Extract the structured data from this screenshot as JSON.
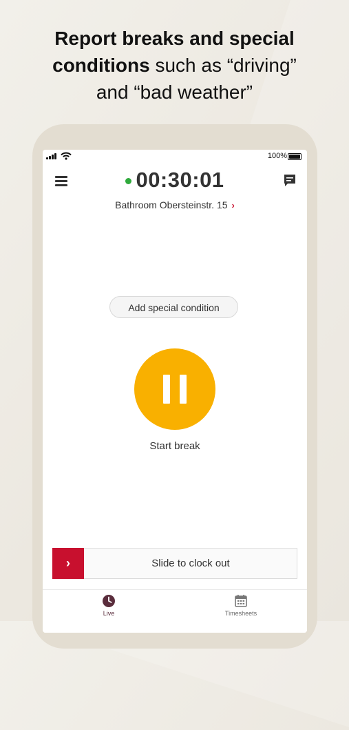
{
  "headline": {
    "line1_bold": "Report breaks and special",
    "line2_bold": "conditions",
    "line2_rest": " such as “driving”",
    "line3": "and “bad weather”"
  },
  "status_bar": {
    "battery": "100%"
  },
  "timer": {
    "value": "00:30:01",
    "status_color": "#2faa3c"
  },
  "location": {
    "name": "Bathroom Obersteinstr. 15",
    "chevron": "›"
  },
  "special_condition_button": {
    "label": "Add special condition"
  },
  "break_button": {
    "label": "Start break",
    "color": "#f9b000"
  },
  "slider": {
    "label": "Slide to clock out",
    "handle_icon": "›",
    "color": "#c8102e"
  },
  "tabs": [
    {
      "label": "Live",
      "icon": "clock-icon"
    },
    {
      "label": "Timesheets",
      "icon": "calendar-icon"
    }
  ]
}
